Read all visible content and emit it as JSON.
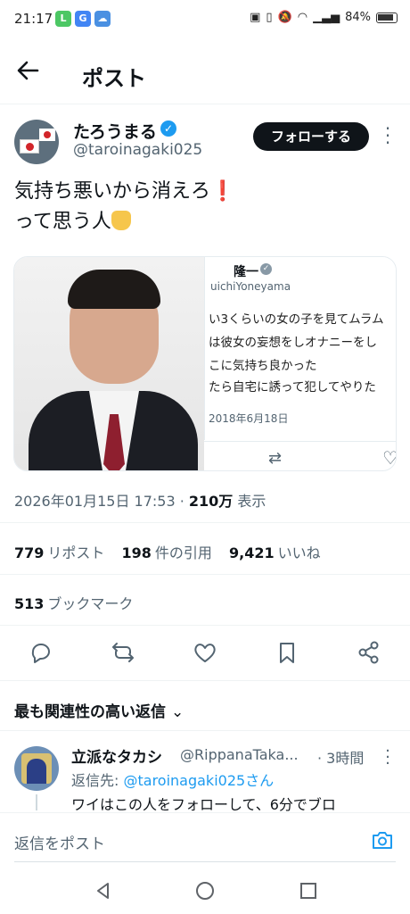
{
  "status_bar": {
    "time": "21:17",
    "battery": "84%",
    "app_icons": [
      {
        "name": "line-icon",
        "color": "#4cc764",
        "glyph": "L"
      },
      {
        "name": "google-icon",
        "color": "#4285f4",
        "glyph": "G"
      },
      {
        "name": "cloud-icon",
        "color": "#4a90e2",
        "glyph": "☁"
      }
    ]
  },
  "header": {
    "title": "ポスト"
  },
  "post": {
    "author_name": "たろうまる",
    "author_handle": "@taroinagaki025",
    "follow_label": "フォローする",
    "text_line1": "気持ち悪いから消えろ",
    "text_line1_emoji": "❗",
    "text_line2": "って思う人",
    "media": {
      "embedded_name": "隆一",
      "embedded_handle": "uichiYoneyama",
      "embedded_lines": [
        "い3くらいの女の子を見てムラム",
        "は彼女の妄想をしオナニーをし",
        "こに気持ち良かった",
        "たら自宅に誘って犯してやりた"
      ],
      "embedded_date": "2018年6月18日"
    },
    "timestamp": "2026年01月15日 17:53 · ",
    "views": "210万",
    "views_label": "表示"
  },
  "stats": {
    "reposts": "779",
    "reposts_label": "リポスト",
    "quotes": "198",
    "quotes_label": "件の引用",
    "likes": "9,421",
    "likes_label": "いいね",
    "bookmarks": "513",
    "bookmarks_label": "ブックマーク"
  },
  "replies": {
    "section_title": "最も関連性の高い返信",
    "items": [
      {
        "name": "立派なタカシ",
        "handle": "@RippanaTaka...",
        "time": "· 3時間",
        "reply_to_prefix": "返信先: ",
        "reply_to_handle": "@taroinagaki025さん",
        "text": "ワイはこの人をフォローして、6分でブロ"
      }
    ]
  },
  "composer": {
    "placeholder": "返信をポスト"
  },
  "colors": {
    "accent": "#1d9bf0",
    "text": "#0f1419",
    "muted": "#536471"
  }
}
